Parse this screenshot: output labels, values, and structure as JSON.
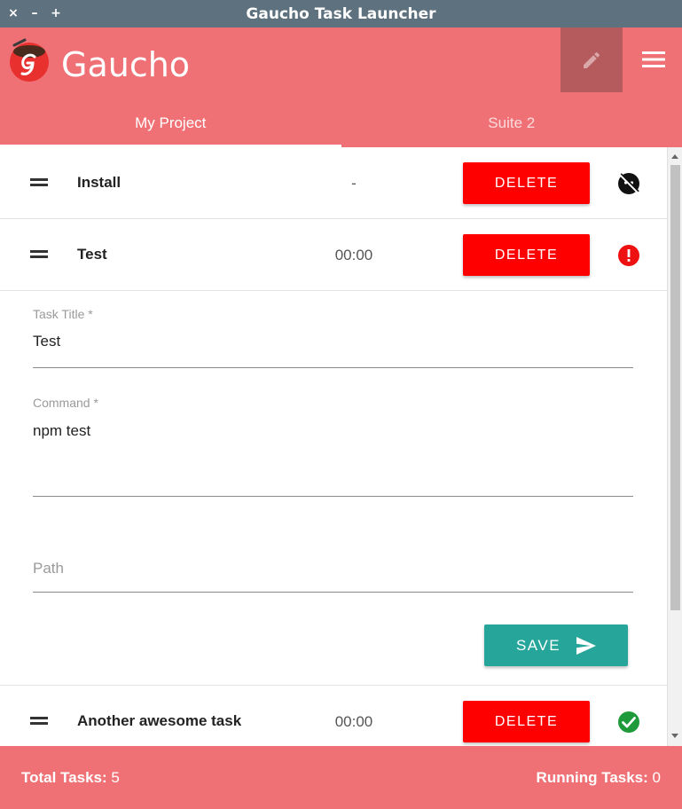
{
  "window": {
    "title": "Gaucho Task Launcher",
    "controls": [
      "×",
      "–",
      "+"
    ]
  },
  "header": {
    "brand": "Gaucho",
    "tabs": [
      {
        "label": "My Project",
        "active": true
      },
      {
        "label": "Suite 2",
        "active": false
      }
    ]
  },
  "tasks": [
    {
      "name": "Install",
      "time": "-",
      "delete_label": "DELETE",
      "status": "idle"
    },
    {
      "name": "Test",
      "time": "00:00",
      "delete_label": "DELETE",
      "status": "error"
    },
    {
      "name": "Another awesome task",
      "time": "00:00",
      "delete_label": "DELETE",
      "status": "success"
    }
  ],
  "edit_form": {
    "title_label": "Task Title *",
    "title_value": "Test",
    "command_label": "Command *",
    "command_value": "npm test",
    "path_label": "Path",
    "path_value": "",
    "save_label": "SAVE"
  },
  "footer": {
    "total_label": "Total Tasks:",
    "total_value": "5",
    "running_label": "Running Tasks:",
    "running_value": "0"
  },
  "colors": {
    "primary": "#ef7175",
    "titlebar": "#5e717e",
    "delete": "#ff0000",
    "save": "#26a69a",
    "status_error": "#ee1111",
    "status_success": "#1e9a3a"
  }
}
